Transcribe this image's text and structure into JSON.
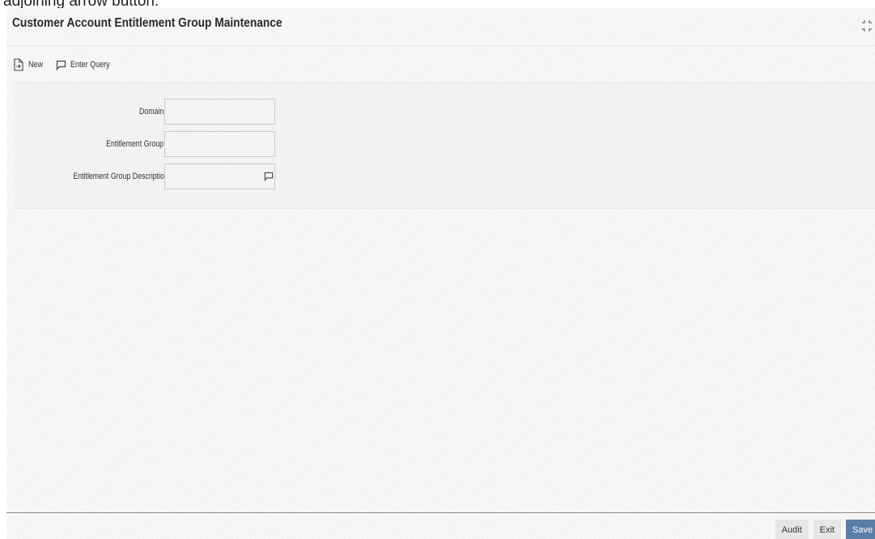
{
  "caption": {
    "text": "adjoining arrow button."
  },
  "window": {
    "title": "Customer Account Entitlement Group Maintenance",
    "resize_icon": "collapse-arrows-icon"
  },
  "toolbar": {
    "new_label": "New",
    "new_icon": "new-document-icon",
    "enter_query_label": "Enter Query",
    "enter_query_icon": "speech-bubble-icon"
  },
  "form": {
    "fields": [
      {
        "label": "Domain",
        "required": "*",
        "value": "",
        "placeholder": ""
      },
      {
        "label": "Entitlement Group",
        "required": "*",
        "value": "",
        "placeholder": ""
      },
      {
        "label": "Entitlement Group Description",
        "required": "",
        "value": "",
        "placeholder": "",
        "icon": "speech-bubble-icon"
      }
    ]
  },
  "footer": {
    "audit_label": "Audit",
    "exit_label": "Exit",
    "save_label": "Save"
  },
  "colors": {
    "required_marker": "#d03030",
    "primary_button": "#5a7ea6"
  }
}
